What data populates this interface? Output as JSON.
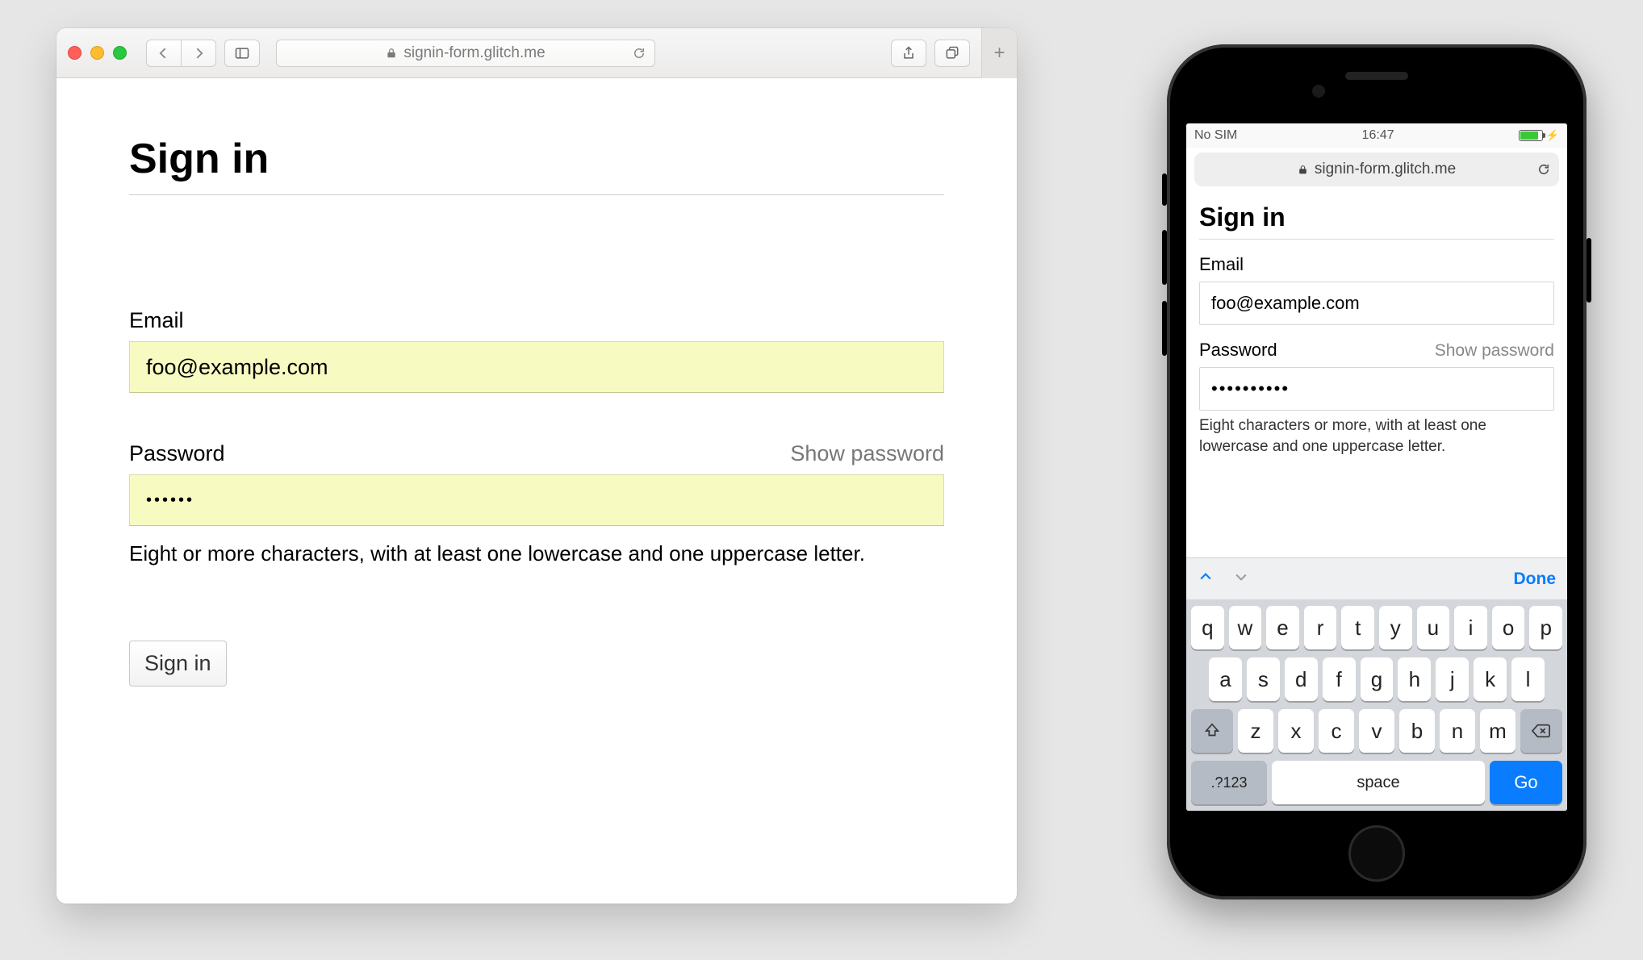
{
  "desktop": {
    "url_display": "signin-form.glitch.me",
    "page": {
      "title": "Sign in",
      "email": {
        "label": "Email",
        "value": "foo@example.com"
      },
      "password": {
        "label": "Password",
        "show_label": "Show password",
        "value": "••••••",
        "hint": "Eight or more characters, with at least one lowercase and one uppercase letter."
      },
      "submit_label": "Sign in"
    }
  },
  "mobile": {
    "status": {
      "carrier": "No SIM",
      "time": "16:47"
    },
    "url_display": "signin-form.glitch.me",
    "page": {
      "title": "Sign in",
      "email": {
        "label": "Email",
        "value": "foo@example.com"
      },
      "password": {
        "label": "Password",
        "show_label": "Show password",
        "value": "••••••••••",
        "hint": "Eight characters or more, with at least one lowercase and one uppercase letter."
      }
    },
    "keyboard": {
      "done_label": "Done",
      "row1": [
        "q",
        "w",
        "e",
        "r",
        "t",
        "y",
        "u",
        "i",
        "o",
        "p"
      ],
      "row2": [
        "a",
        "s",
        "d",
        "f",
        "g",
        "h",
        "j",
        "k",
        "l"
      ],
      "row3": [
        "z",
        "x",
        "c",
        "v",
        "b",
        "n",
        "m"
      ],
      "num_label": ".?123",
      "space_label": "space",
      "go_label": "Go"
    }
  }
}
